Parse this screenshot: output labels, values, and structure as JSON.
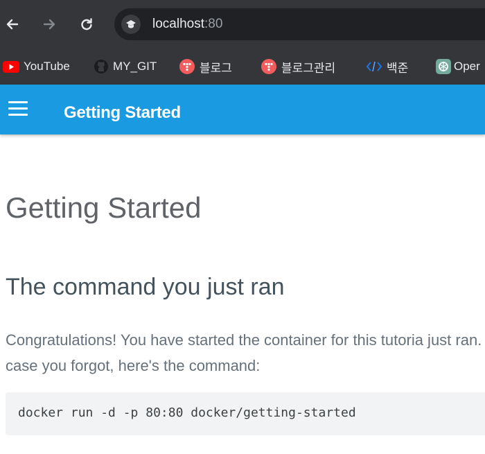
{
  "browser": {
    "url_host": "localhost",
    "url_port": ":80",
    "bookmarks": [
      {
        "label": "YouTube",
        "icon": "youtube-icon"
      },
      {
        "label": "MY_GIT",
        "icon": "github-icon"
      },
      {
        "label": "블로그",
        "icon": "tistory-icon"
      },
      {
        "label": "블로그관리",
        "icon": "tistory-icon"
      },
      {
        "label": "백준",
        "icon": "code-icon"
      },
      {
        "label": "Oper",
        "icon": "openai-icon"
      }
    ]
  },
  "app_bar": {
    "title": "Getting Started",
    "color": "#1a9ae0"
  },
  "content": {
    "page_title": "Getting Started",
    "section_heading": "The command you just ran",
    "paragraph": "Congratulations! You have started the container for this tutoria just ran. In case you forgot, here's the command:",
    "code": "docker run -d -p 80:80 docker/getting-started"
  }
}
